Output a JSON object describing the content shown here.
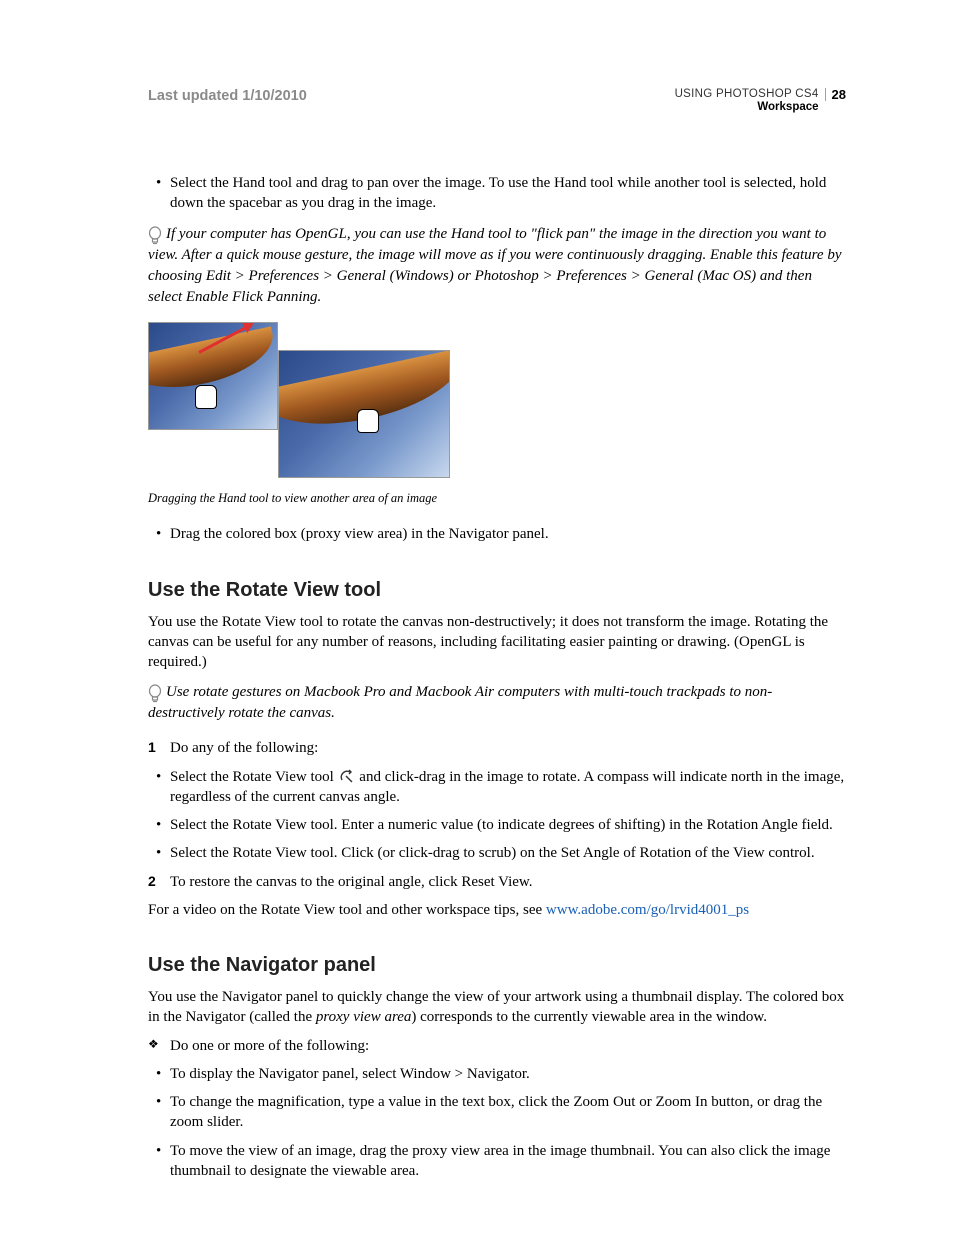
{
  "header": {
    "last_updated": "Last updated 1/10/2010",
    "doc_title": "USING PHOTOSHOP CS4",
    "section": "Workspace",
    "page_number": "28"
  },
  "hand_tool": {
    "bullet1": "Select the Hand tool and drag to pan over the image. To use the Hand tool while another tool is selected, hold down the spacebar as you drag in the image.",
    "tip": "If your computer has OpenGL, you can use the Hand tool to \"flick pan\" the image in the direction you want to view. After a quick mouse gesture, the image will move as if you were continuously dragging. Enable this feature by choosing Edit > Preferences > General (Windows) or Photoshop > Preferences > General (Mac OS) and then select Enable Flick Panning.",
    "caption": "Dragging the Hand tool to view another area of an image",
    "bullet2": "Drag the colored box (proxy view area) in the Navigator panel."
  },
  "rotate_view": {
    "heading": "Use the Rotate View tool",
    "intro": "You use the Rotate View tool to rotate the canvas non-destructively; it does not transform the image. Rotating the canvas can be useful for any number of reasons, including facilitating easier painting or drawing. (OpenGL is required.)",
    "tip": "Use rotate gestures on Macbook Pro and Macbook Air computers with multi-touch trackpads to non-destructively rotate the canvas.",
    "step1": "Do any of the following:",
    "sub1_before": "Select the Rotate View tool ",
    "sub1_after": " and click-drag in the image to rotate. A compass will indicate north in the image, regardless of the current canvas angle.",
    "sub2": "Select the Rotate View tool. Enter a numeric value (to indicate degrees of shifting) in the Rotation Angle field.",
    "sub3": "Select the Rotate View tool. Click (or click-drag to scrub) on the Set Angle of Rotation of the View control.",
    "step2": "To restore the canvas to the original angle, click Reset View.",
    "video_text": "For a video on the Rotate View tool and other workspace tips, see ",
    "video_link": "www.adobe.com/go/lrvid4001_ps"
  },
  "navigator": {
    "heading": "Use the Navigator panel",
    "intro_before": "You use the Navigator panel to quickly change the view of your artwork using a thumbnail display. The colored box in the Navigator (called the ",
    "intro_italic": "proxy view area",
    "intro_after": ") corresponds to the currently viewable area in the window.",
    "diamond": "Do one or more of the following:",
    "b1": "To display the Navigator panel, select Window > Navigator.",
    "b2": "To change the magnification, type a value in the text box, click the Zoom Out or Zoom In button, or drag the zoom slider.",
    "b3": "To move the view of an image, drag the proxy view area in the image thumbnail. You can also click the image thumbnail to designate the viewable area."
  }
}
